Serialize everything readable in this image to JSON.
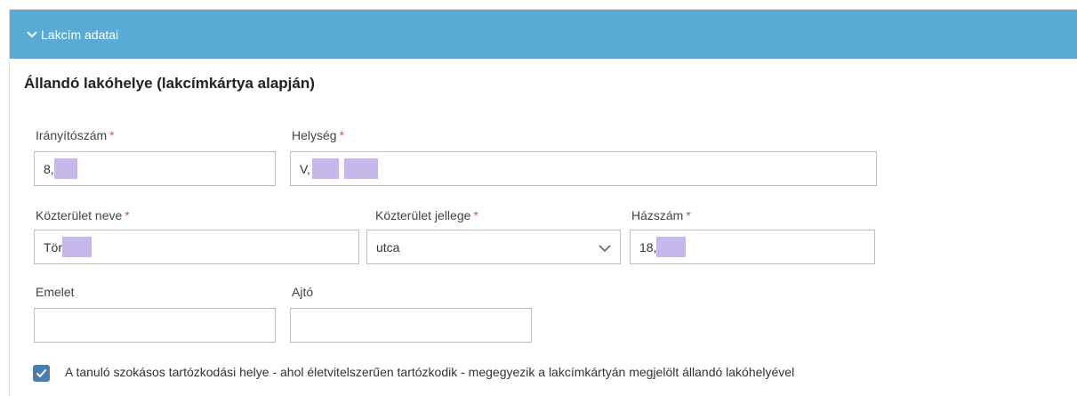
{
  "panel": {
    "header_title": "Lakcím adatai"
  },
  "section": {
    "title": "Állandó lakóhelye (lakcímkártya alapján)"
  },
  "fields": {
    "iranyitoszam": {
      "label": "Irányítószám",
      "required_mark": "*",
      "value": "8,"
    },
    "helyseg": {
      "label": "Helység",
      "required_mark": "*",
      "value": "V,"
    },
    "kozterulet_neve": {
      "label": "Közterület neve",
      "required_mark": "*",
      "value": "Tör"
    },
    "kozterulet_jellege": {
      "label": "Közterület jellege",
      "required_mark": "*",
      "value": "utca"
    },
    "hazszam": {
      "label": "Házszám",
      "required_mark": "*",
      "value": "18,"
    },
    "emelet": {
      "label": "Emelet",
      "value": ""
    },
    "ajto": {
      "label": "Ajtó",
      "value": ""
    }
  },
  "checkbox": {
    "checked": true,
    "label": "A tanuló szokásos tartózkodási helye - ahol életvitelszerűen tartózkodik - megegyezik a lakcímkártyán megjelölt állandó lakóhelyével"
  },
  "colors": {
    "header_bg": "#5aaad6",
    "required": "#d9534f",
    "checkbox": "#4a7eaa",
    "redaction": "#c7b8eb"
  },
  "icons": {
    "header_toggle": "chevron-down-icon",
    "select_arrow": "chevron-down-icon",
    "checkbox": "checkmark-icon"
  }
}
